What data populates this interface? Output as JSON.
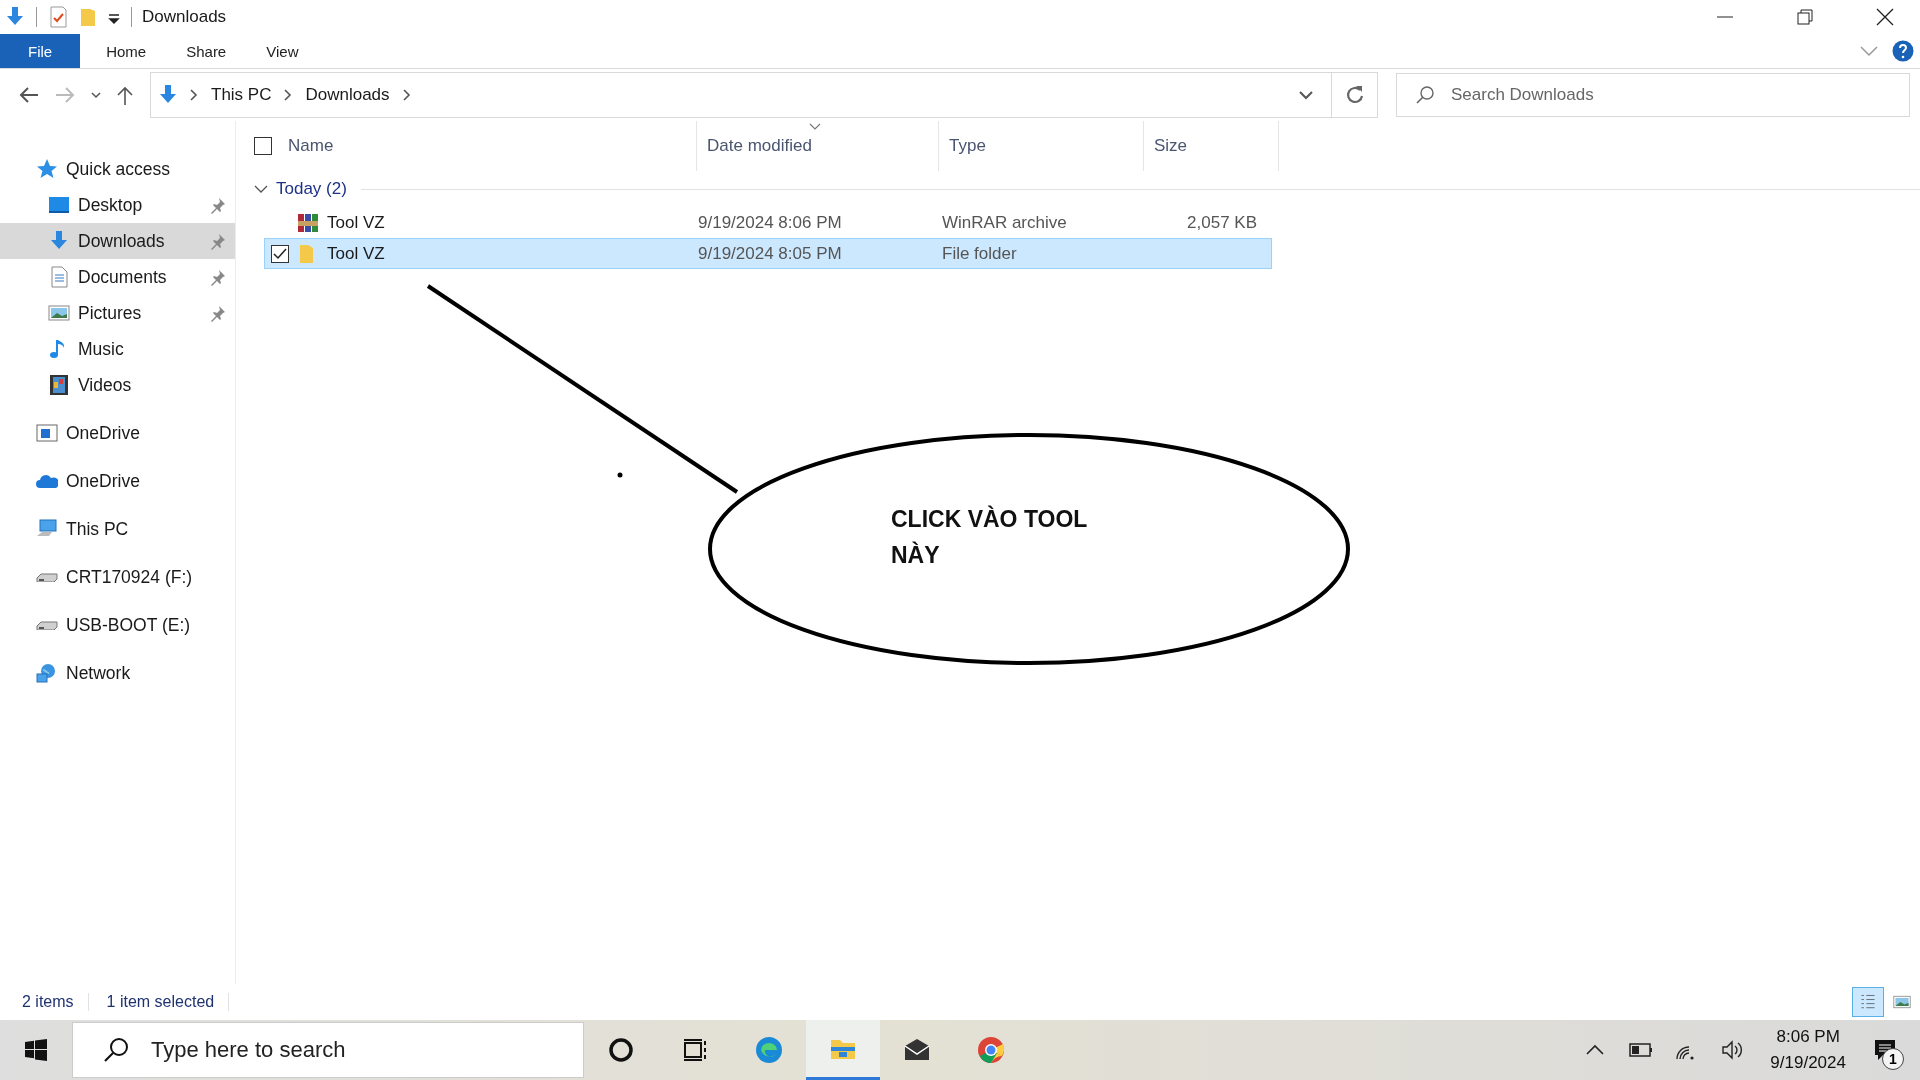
{
  "window": {
    "title": "Downloads"
  },
  "ribbon": {
    "tabs": [
      {
        "label": "File",
        "kind": "file"
      },
      {
        "label": "Home",
        "kind": "tab"
      },
      {
        "label": "Share",
        "kind": "tab"
      },
      {
        "label": "View",
        "kind": "tab"
      }
    ]
  },
  "address_bar": {
    "path": [
      "This PC",
      "Downloads"
    ]
  },
  "search": {
    "placeholder": "Search Downloads"
  },
  "sidebar": {
    "items": [
      {
        "label": "Quick access",
        "kind": "star",
        "selected": false,
        "pinned": false,
        "children": [
          {
            "label": "Desktop",
            "kind": "desktop",
            "selected": false,
            "pinned": true
          },
          {
            "label": "Downloads",
            "kind": "download",
            "selected": true,
            "pinned": true
          },
          {
            "label": "Documents",
            "kind": "document",
            "selected": false,
            "pinned": true
          },
          {
            "label": "Pictures",
            "kind": "picture",
            "selected": false,
            "pinned": true
          },
          {
            "label": "Music",
            "kind": "music",
            "selected": false,
            "pinned": false
          },
          {
            "label": "Videos",
            "kind": "video",
            "selected": false,
            "pinned": false
          }
        ]
      },
      {
        "label": "OneDrive",
        "kind": "window",
        "selected": false,
        "pinned": false
      },
      {
        "label": "OneDrive",
        "kind": "cloud",
        "selected": false,
        "pinned": false
      },
      {
        "label": "This PC",
        "kind": "computer",
        "selected": false,
        "pinned": false
      },
      {
        "label": "CRT170924 (F:)",
        "kind": "drive",
        "selected": false,
        "pinned": false
      },
      {
        "label": "USB-BOOT (E:)",
        "kind": "drive",
        "selected": false,
        "pinned": false
      },
      {
        "label": "Network",
        "kind": "network",
        "selected": false,
        "pinned": false
      }
    ]
  },
  "table": {
    "select_all": {
      "checked": false
    },
    "columns": [
      {
        "label": "Name",
        "sorted": false
      },
      {
        "label": "Date modified",
        "sorted": true
      },
      {
        "label": "Type",
        "sorted": false
      },
      {
        "label": "Size",
        "sorted": false
      }
    ],
    "groups": [
      {
        "label": "Today (2)",
        "expanded": true,
        "rows": [
          {
            "kind": "archive",
            "name": "Tool VZ",
            "date": "9/19/2024 8:06 PM",
            "type": "WinRAR archive",
            "size": "2,057 KB",
            "selected": false
          },
          {
            "kind": "folder",
            "name": "Tool VZ",
            "date": "9/19/2024 8:05 PM",
            "type": "File folder",
            "selected": true
          }
        ]
      }
    ]
  },
  "annotation": {
    "text": "CLICK VÀO TOOL NÀY"
  },
  "status_bar": {
    "item_count": "2 items",
    "selection": "1 item selected",
    "views": [
      {
        "kind": "details",
        "selected": true
      },
      {
        "kind": "tiles",
        "selected": false
      }
    ]
  },
  "taskbar": {
    "search_placeholder": "Type here to search",
    "apps": [
      {
        "kind": "cortana",
        "active": false
      },
      {
        "kind": "task-view",
        "active": false
      },
      {
        "kind": "edge",
        "active": false
      },
      {
        "kind": "explorer",
        "active": true
      },
      {
        "kind": "mail",
        "active": false
      },
      {
        "kind": "chrome",
        "active": false
      }
    ],
    "clock": {
      "time": "8:06 PM",
      "date": "9/19/2024"
    },
    "notifications": "1"
  }
}
